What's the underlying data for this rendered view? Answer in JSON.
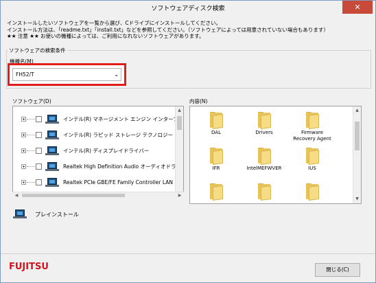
{
  "window": {
    "title": "ソフトウェアディスク検索",
    "close_glyph": "✕"
  },
  "instructions": [
    "インストールしたいソフトウェアを一覧から選び、Cドライブにインストールしてください。",
    "インストール方法は、「readme.txt」「install.txt」などを参照してください。（ソフトウェアによっては用意されていない場合もあります）",
    "★★ 注意 ★★ お使いの機種によっては、ご利用になれないソフトウェアがあります。"
  ],
  "search_conditions": {
    "group_label": "ソフトウェアの検索条件",
    "model_label": "機種名(M)",
    "model_value": "FH52/T",
    "highlight_color": "#e21b1b"
  },
  "software": {
    "label": "ソフトウェア(D)",
    "items": [
      {
        "name": "インテル(R) マネージメント エンジン インターフェース",
        "icon": "laptop-icon"
      },
      {
        "name": "インテル(R) ラピッド ストレージ テクノロジー",
        "icon": "laptop-icon"
      },
      {
        "name": "インテル(R) ディスプレイドライバー",
        "icon": "laptop-icon"
      },
      {
        "name": "Realtek High Definition Audio オーディオドライバー",
        "icon": "laptop-icon"
      },
      {
        "name": "Realtek PCIe GBE/FE Family Controller LAN ドライバー",
        "icon": "laptop-icon"
      },
      {
        "name": "",
        "icon": "laptop-icon"
      }
    ]
  },
  "contents": {
    "label": "内容(N)",
    "folders": [
      {
        "name": "DAL",
        "name2": ""
      },
      {
        "name": "Drivers",
        "name2": ""
      },
      {
        "name": "Firmware",
        "name2": "Recovery Agent"
      },
      {
        "name": "IFR",
        "name2": ""
      },
      {
        "name": "IntelMEFWVER",
        "name2": ""
      },
      {
        "name": "IUS",
        "name2": ""
      },
      {
        "name": "",
        "name2": ""
      },
      {
        "name": "",
        "name2": ""
      },
      {
        "name": "",
        "name2": ""
      }
    ]
  },
  "preinstall": {
    "label": "プレインストール",
    "icon": "laptop-icon"
  },
  "footer": {
    "logo": "FUJITSU",
    "logo_color": "#d4121e",
    "close_button": "閉じる(C)"
  }
}
